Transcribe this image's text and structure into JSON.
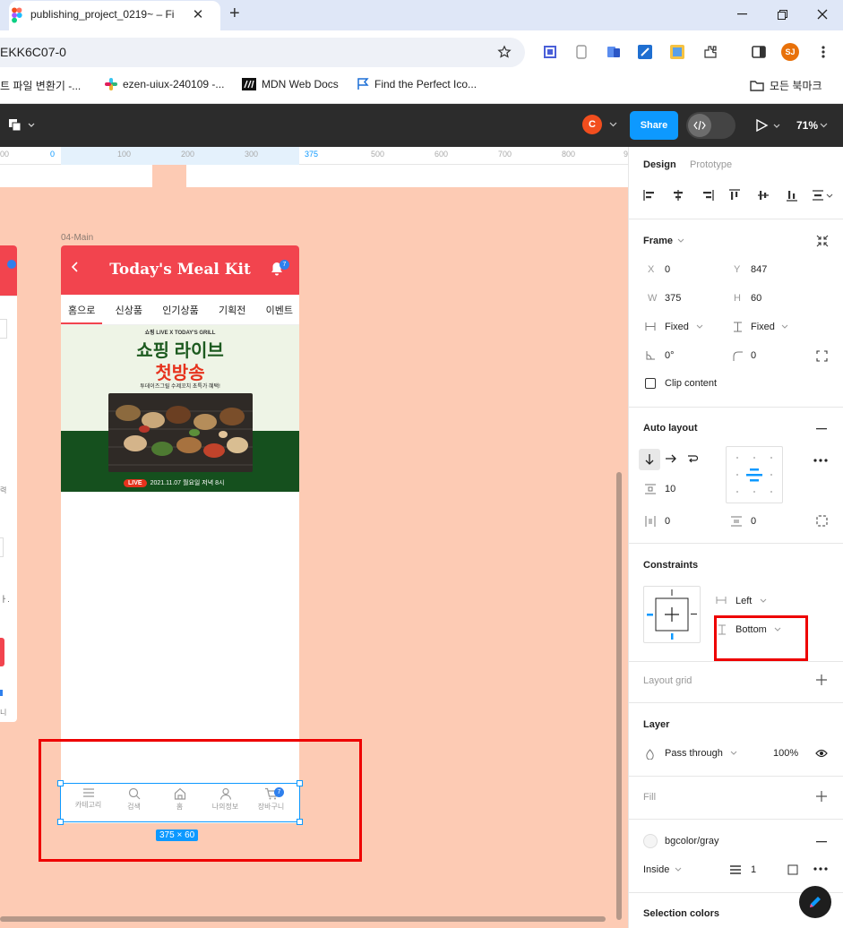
{
  "browser": {
    "tab_title": "publishing_project_0219~ – Fi",
    "url": "EKK6C07-0",
    "profile_initials": "SJ",
    "bookmarks": [
      {
        "label": "트 파일 변환기 -..."
      },
      {
        "label": "ezen-uiux-240109 -..."
      },
      {
        "label": "MDN Web Docs"
      },
      {
        "label": "Find the Perfect Ico..."
      }
    ],
    "all_bookmarks": "모든 북마크"
  },
  "figma": {
    "user_initial": "C",
    "share_label": "Share",
    "zoom": "71%"
  },
  "ruler": {
    "ticks": [
      "00",
      "0",
      "100",
      "200",
      "300",
      "375",
      "500",
      "600",
      "700",
      "800",
      "9"
    ]
  },
  "canvas": {
    "frame_label": "04-Main",
    "app_title": "Today's Meal Kit",
    "bell_count": "7",
    "menu": [
      "홈으로",
      "신상품",
      "인기상품",
      "기획전",
      "이벤트"
    ],
    "banner": {
      "brand": "쇼핑 LIVE X TODAY'S GRILL",
      "live_word": "LIVE",
      "line1": "쇼핑 라이브",
      "line2": "첫방송",
      "subtitle": "투데이즈그릴 수제꼬치 초특가 혜택!",
      "live_label": "LIVE",
      "date": "2021.11.07 월요일 저녁 8시"
    },
    "nav": [
      {
        "label": "카테고리",
        "icon": "menu-icon"
      },
      {
        "label": "검색",
        "icon": "search-icon"
      },
      {
        "label": "홈",
        "icon": "home-icon"
      },
      {
        "label": "나의정보",
        "icon": "user-icon"
      },
      {
        "label": "장바구니",
        "icon": "cart-icon"
      }
    ],
    "cart_count": "7",
    "size_label": "375 × 60",
    "left_frame_texts": [
      "력",
      "ㅏ.",
      "니"
    ]
  },
  "panel": {
    "tabs": {
      "design": "Design",
      "prototype": "Prototype"
    },
    "frame": {
      "title": "Frame",
      "x_label": "X",
      "x": "0",
      "y_label": "Y",
      "y": "847",
      "w_label": "W",
      "w": "375",
      "h_label": "H",
      "h": "60",
      "h_sizing": "Fixed",
      "v_sizing": "Fixed",
      "rotation": "0°",
      "radius": "0",
      "clip_content": "Clip content"
    },
    "auto_layout": {
      "title": "Auto layout",
      "gap": "10",
      "padding_h": "0",
      "padding_v": "0"
    },
    "constraints": {
      "title": "Constraints",
      "horizontal": "Left",
      "vertical": "Bottom"
    },
    "layout_grid": "Layout grid",
    "layer": {
      "title": "Layer",
      "blend": "Pass through",
      "opacity": "100%"
    },
    "fill": "Fill",
    "stroke": {
      "style": "bgcolor/gray",
      "position": "Inside",
      "weight": "1"
    },
    "selection_colors": "Selection colors"
  },
  "colors": {
    "canvas": "#fdcbb4",
    "accent": "#0d99ff",
    "app_red": "#f2444e",
    "highlight": "#ee0000"
  }
}
